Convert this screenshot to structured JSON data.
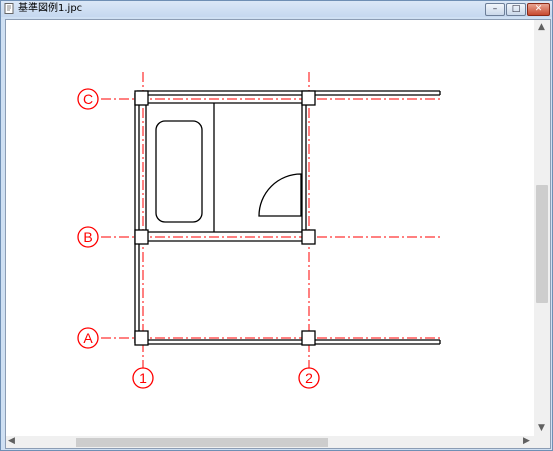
{
  "window": {
    "title": "基準図例1.jpc",
    "minimize_icon": "minimize-icon",
    "maximize_icon": "maximize-icon",
    "close_icon": "close-icon"
  },
  "drawing": {
    "axis_labels": [
      "C",
      "B",
      "A"
    ],
    "column_labels": [
      "1",
      "2"
    ],
    "colors": {
      "gridline": "#ff0000",
      "wall": "#000000",
      "background": "#ffffff"
    }
  },
  "scrollbars": {
    "up_arrow": "▲",
    "down_arrow": "▼",
    "left_arrow": "◀",
    "right_arrow": "▶"
  }
}
